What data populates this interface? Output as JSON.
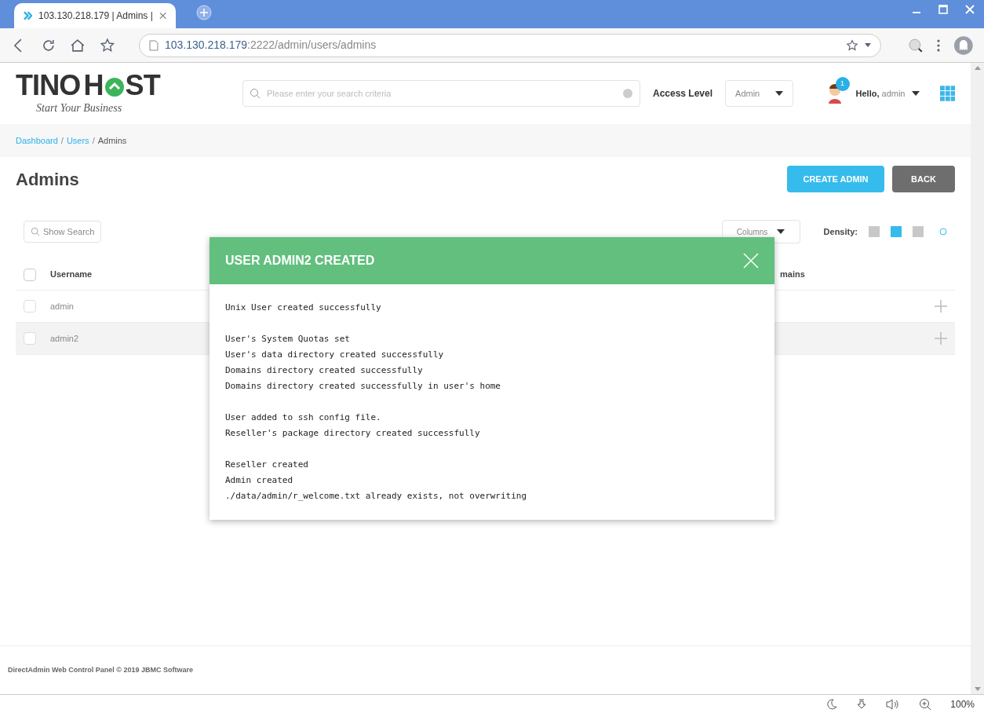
{
  "browser": {
    "tab_title": "103.130.218.179 | Admins |",
    "url_host": "103.130.218.179",
    "url_rest": ":2222/admin/users/admins",
    "zoom": "100%"
  },
  "header": {
    "logo_text_1": "TINO",
    "logo_text_2": "H",
    "logo_text_3": "ST",
    "logo_tagline": "Start Your Business",
    "search_placeholder": "Please enter your search criteria",
    "access_level_label": "Access Level",
    "access_level_value": "Admin",
    "notification_count": "1",
    "greeting": "Hello,",
    "username": "admin"
  },
  "breadcrumb_separator": "/",
  "breadcrumb": [
    {
      "label": "Dashboard",
      "link": true
    },
    {
      "label": "Users",
      "link": true
    },
    {
      "label": "Admins",
      "link": false
    }
  ],
  "page_title": "Admins",
  "actions": [
    {
      "label": "CREATE ADMIN",
      "kind": "primary"
    },
    {
      "label": "BACK",
      "kind": "secondary"
    }
  ],
  "toolbar": {
    "show_search": "Show Search",
    "columns": "Columns",
    "density_label": "Density:",
    "density": [
      {
        "selected": false
      },
      {
        "selected": true
      },
      {
        "selected": false
      }
    ]
  },
  "table": {
    "select_all_checked": false,
    "columns": [
      "Username",
      "mains"
    ],
    "rows": [
      {
        "username": "admin",
        "checked": false,
        "selected": false
      },
      {
        "username": "admin2",
        "checked": false,
        "selected": true
      }
    ]
  },
  "footer": "DirectAdmin Web Control Panel © 2019 JBMC Software",
  "modal": {
    "title": "USER ADMIN2 CREATED",
    "message_groups": [
      [
        "Unix User created successfully"
      ],
      [
        "User's System Quotas set",
        "User's data directory created successfully",
        "Domains directory created successfully",
        "Domains directory created successfully in user's home"
      ],
      [
        "User added to ssh config file.",
        "Reseller's package directory created successfully"
      ],
      [
        "Reseller created",
        "Admin created",
        "./data/admin/r_welcome.txt already exists, not overwriting"
      ]
    ]
  }
}
